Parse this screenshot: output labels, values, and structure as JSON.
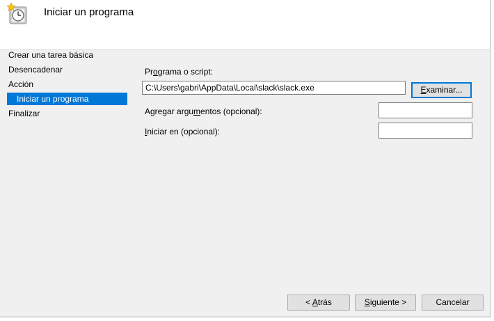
{
  "header": {
    "title": "Iniciar un programa",
    "icon": "task-scheduler-clock-icon"
  },
  "nav": {
    "items": [
      {
        "label": "Crear una tarea básica",
        "selected": false
      },
      {
        "label": "Desencadenar",
        "selected": false
      },
      {
        "label": "Acción",
        "selected": false
      },
      {
        "label": "Iniciar un programa",
        "selected": true
      },
      {
        "label": "Finalizar",
        "selected": false
      }
    ]
  },
  "form": {
    "program_label_pre": "Pr",
    "program_label_accel": "o",
    "program_label_post": "grama o script:",
    "program_value": "C:\\Users\\gabri\\AppData\\Local\\slack\\slack.exe",
    "browse_label_accel": "E",
    "browse_label_rest": "xaminar...",
    "args_label_pre": "Agregar argu",
    "args_label_accel": "m",
    "args_label_post": "entos (opcional):",
    "args_value": "",
    "startin_label_accel": "I",
    "startin_label_post": "niciar en (opcional):",
    "startin_value": ""
  },
  "footer": {
    "back_pre": "< ",
    "back_accel": "A",
    "back_post": "trás",
    "next_accel": "S",
    "next_post": "iguiente >",
    "cancel_label": "Cancelar"
  },
  "colors": {
    "selection": "#0078d7",
    "panel_bg": "#f0f0f0",
    "button_bg": "#e1e1e1"
  }
}
